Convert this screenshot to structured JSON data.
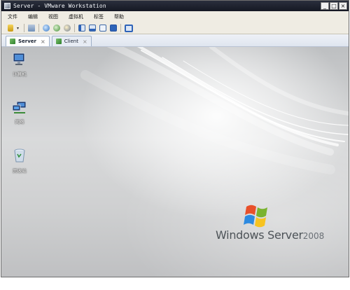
{
  "window": {
    "title": "Server - VMware Workstation",
    "controls": [
      "_",
      "□",
      "×"
    ]
  },
  "menu": {
    "items": [
      "文件",
      "编辑",
      "视图",
      "虚拟机",
      "标签",
      "帮助"
    ]
  },
  "tabs": [
    {
      "label": "Server",
      "active": true
    },
    {
      "label": "Client",
      "active": false
    }
  ],
  "desktop": {
    "icons": [
      {
        "label": "计算机",
        "icon": "computer-icon"
      },
      {
        "label": "网络",
        "icon": "network-icon"
      },
      {
        "label": "回收站",
        "icon": "recycle-bin-icon"
      }
    ],
    "brand": {
      "name": "Windows Server",
      "version": "2008"
    }
  }
}
